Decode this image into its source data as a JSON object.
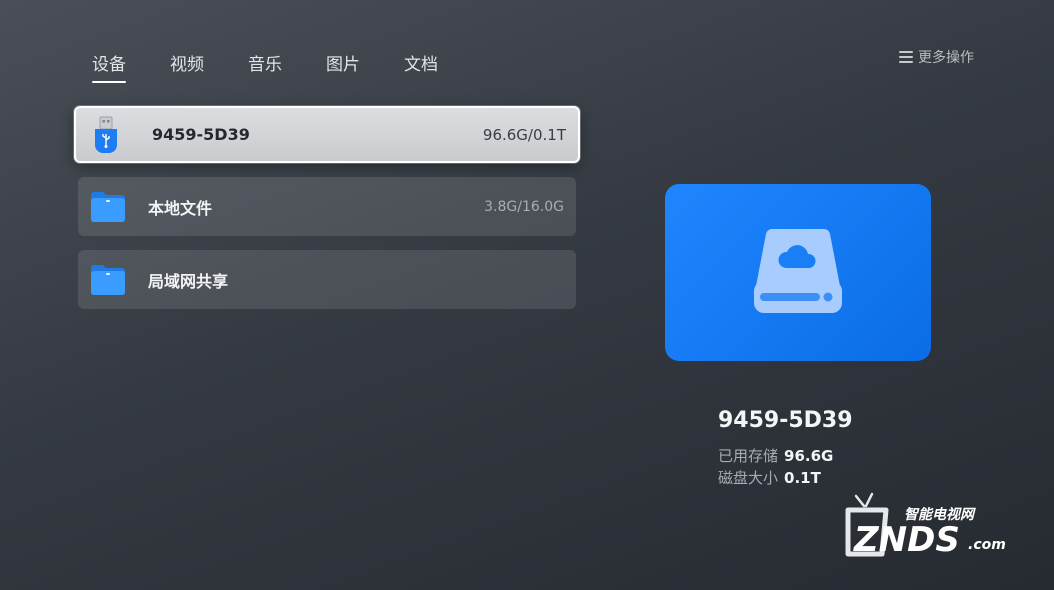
{
  "tabs": [
    {
      "label": "设备"
    },
    {
      "label": "视频"
    },
    {
      "label": "音乐"
    },
    {
      "label": "图片"
    },
    {
      "label": "文档"
    }
  ],
  "more_actions": "更多操作",
  "devices": [
    {
      "name": "9459-5D39",
      "size": "96.6G/0.1T",
      "icon": "usb-drive-icon"
    },
    {
      "name": "本地文件",
      "size": "3.8G/16.0G",
      "icon": "folder-icon"
    },
    {
      "name": "局域网共享",
      "size": "",
      "icon": "folder-icon"
    }
  ],
  "detail": {
    "title": "9459-5D39",
    "used_label": "已用存储",
    "used_value": "96.6G",
    "disk_label": "磁盘大小",
    "disk_value": "0.1T",
    "icon": "cloud-drive-icon"
  },
  "watermark": {
    "top": "智能电视网",
    "brand": "ZNDS",
    "suffix": ".com"
  },
  "colors": {
    "accent": "#1a7ff5",
    "folder": "#3b9cff"
  }
}
